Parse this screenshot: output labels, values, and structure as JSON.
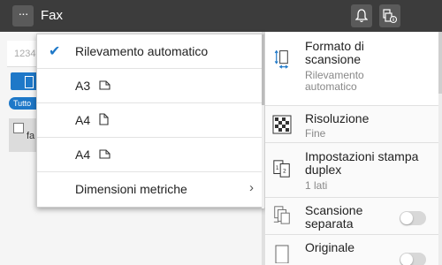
{
  "header": {
    "menu_label": "···",
    "title": "Fax",
    "icons": [
      "bell-icon",
      "device-info-icon"
    ]
  },
  "left": {
    "field_placeholder": "1234",
    "chip_label": "Tutto",
    "row_text": "fa"
  },
  "dropdown": {
    "items": [
      {
        "label": "Rilevamento automatico",
        "selected": true
      },
      {
        "label": "A3",
        "orientation": "landscape"
      },
      {
        "label": "A4",
        "orientation": "portrait"
      },
      {
        "label": "A4",
        "orientation": "landscape"
      },
      {
        "label": "Dimensioni metriche",
        "submenu": true
      }
    ]
  },
  "settings": [
    {
      "title": "Formato di scansione",
      "value": "Rilevamento automatico",
      "selected": true
    },
    {
      "title": "Risoluzione",
      "value": "Fine"
    },
    {
      "title": "Impostazioni stampa duplex",
      "value": "1 lati"
    },
    {
      "title": "Scansione separata",
      "toggle": false
    },
    {
      "title": "Originale",
      "toggle": false
    }
  ],
  "colors": {
    "accent": "#1e78c8",
    "topbar": "#3c3c3c"
  }
}
